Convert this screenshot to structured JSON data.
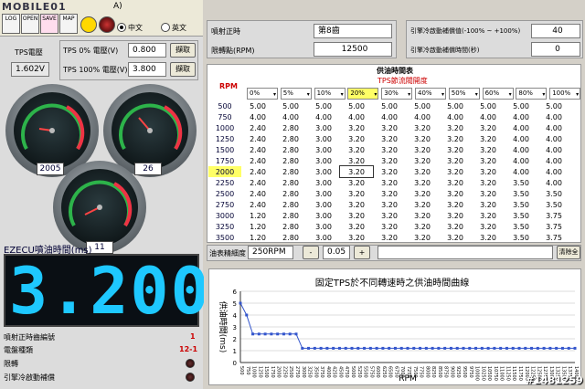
{
  "topbar": {
    "brand": "MOBILE01",
    "title_frag": "A)",
    "icons": [
      "LOG",
      "OPEN",
      "SAVE",
      "MAP"
    ],
    "lang_zh": "中文",
    "lang_en": "英文"
  },
  "tps": {
    "voltage_label": "TPS電壓",
    "voltage_value": "1.602V",
    "tps0_label": "TPS 0% 電壓(V)",
    "tps0_value": "0.800",
    "tps100_label": "TPS 100% 電壓(V)",
    "tps100_value": "3.800",
    "capture_label": "擷取"
  },
  "gauges": {
    "rpm_value": "2005",
    "tps_value": "26",
    "fuel_value": "11"
  },
  "ezecu": {
    "title": "EZECU噴油時間(ms)",
    "digits": "3.200"
  },
  "status": {
    "items": [
      {
        "label": "噴射正時齒編號",
        "value": "1"
      },
      {
        "label": "電盤種類",
        "value": "12-1"
      },
      {
        "label": "限轉",
        "value": ""
      },
      {
        "label": "引擎冷啟動補償",
        "value": ""
      }
    ]
  },
  "right_top": {
    "timing_label": "噴射正時",
    "timing_value": "第8齒",
    "limit_label": "限轉點(RPM)",
    "limit_value": "12500",
    "cold_pct_label": "引擎冷啟動補償值(-100% ~ +100%)",
    "cold_pct_value": "40",
    "cold_time_label": "引擎冷啟動補償時間(秒)",
    "cold_time_value": "0"
  },
  "table": {
    "title": "供油時間表",
    "subtitle": "TPS節流閥開度",
    "rpm_header": "RPM",
    "tps_cols": [
      "0%",
      "5%",
      "10%",
      "20%",
      "30%",
      "40%",
      "50%",
      "60%",
      "80%",
      "100%"
    ],
    "rpm_rows": [
      "500",
      "750",
      "1000",
      "1250",
      "1500",
      "1750",
      "2000",
      "2250",
      "2500",
      "2750",
      "3000",
      "3250",
      "3500"
    ],
    "values": [
      [
        "5.00",
        "5.00",
        "5.00",
        "5.00",
        "5.00",
        "5.00",
        "5.00",
        "5.00",
        "5.00",
        "5.00"
      ],
      [
        "4.00",
        "4.00",
        "4.00",
        "4.00",
        "4.00",
        "4.00",
        "4.00",
        "4.00",
        "4.00",
        "4.00"
      ],
      [
        "2.40",
        "2.80",
        "3.00",
        "3.20",
        "3.20",
        "3.20",
        "3.20",
        "3.20",
        "4.00",
        "4.00"
      ],
      [
        "2.40",
        "2.80",
        "3.00",
        "3.20",
        "3.20",
        "3.20",
        "3.20",
        "3.20",
        "4.00",
        "4.00"
      ],
      [
        "2.40",
        "2.80",
        "3.00",
        "3.20",
        "3.20",
        "3.20",
        "3.20",
        "3.20",
        "4.00",
        "4.00"
      ],
      [
        "2.40",
        "2.80",
        "3.00",
        "3.20",
        "3.20",
        "3.20",
        "3.20",
        "3.20",
        "4.00",
        "4.00"
      ],
      [
        "2.40",
        "2.80",
        "3.00",
        "3.20",
        "3.20",
        "3.20",
        "3.20",
        "3.20",
        "4.00",
        "4.00"
      ],
      [
        "2.40",
        "2.80",
        "3.00",
        "3.20",
        "3.20",
        "3.20",
        "3.20",
        "3.20",
        "3.50",
        "4.00"
      ],
      [
        "2.40",
        "2.80",
        "3.00",
        "3.20",
        "3.20",
        "3.20",
        "3.20",
        "3.20",
        "3.50",
        "3.50"
      ],
      [
        "2.40",
        "2.80",
        "3.00",
        "3.20",
        "3.20",
        "3.20",
        "3.20",
        "3.20",
        "3.50",
        "3.50"
      ],
      [
        "1.20",
        "2.80",
        "3.00",
        "3.20",
        "3.20",
        "3.20",
        "3.20",
        "3.20",
        "3.50",
        "3.75"
      ],
      [
        "1.20",
        "2.80",
        "3.00",
        "3.20",
        "3.20",
        "3.20",
        "3.20",
        "3.20",
        "3.50",
        "3.75"
      ],
      [
        "1.20",
        "2.80",
        "3.00",
        "3.20",
        "3.20",
        "3.20",
        "3.20",
        "3.20",
        "3.50",
        "3.75"
      ]
    ]
  },
  "adjust": {
    "label": "油表精細度",
    "step_value": "250RPM",
    "minus": "-",
    "amount": "0.05",
    "plus": "+",
    "clear_label": "清除全部"
  },
  "chart_data": {
    "type": "line",
    "title": "固定TPS於不同轉速時之供油時間曲線",
    "xlabel": "RPM",
    "ylabel": "供油時間(ms)",
    "ylim": [
      0,
      6
    ],
    "yticks": [
      0,
      1,
      2,
      3,
      4,
      5,
      6
    ],
    "x": [
      "500",
      "750",
      "1000",
      "1250",
      "1500",
      "1750",
      "2000",
      "2250",
      "2500",
      "2750",
      "3000",
      "3250",
      "3500",
      "3750",
      "4000",
      "4250",
      "4500",
      "4750",
      "5000",
      "5250",
      "5500",
      "5750",
      "6000",
      "6250",
      "6500",
      "6750",
      "7000",
      "7250",
      "7500",
      "7750",
      "8000",
      "8250",
      "8500",
      "8750",
      "9000",
      "9250",
      "9500",
      "9750",
      "10000",
      "10250",
      "10500",
      "10750",
      "11000",
      "11250",
      "11500",
      "11750",
      "12000",
      "12250",
      "12500",
      "12750",
      "13000",
      "13250",
      "13500",
      "13750",
      "14000"
    ],
    "series": [
      {
        "values": [
          5,
          4,
          2.4,
          2.4,
          2.4,
          2.4,
          2.4,
          2.4,
          2.4,
          2.4,
          1.2,
          1.2,
          1.2,
          1.2,
          1.2,
          1.2,
          1.2,
          1.2,
          1.2,
          1.2,
          1.2,
          1.2,
          1.2,
          1.2,
          1.2,
          1.2,
          1.2,
          1.2,
          1.2,
          1.2,
          1.2,
          1.2,
          1.2,
          1.2,
          1.2,
          1.2,
          1.2,
          1.2,
          1.2,
          1.2,
          1.2,
          1.2,
          1.2,
          1.2,
          1.2,
          1.2,
          1.2,
          1.2,
          1.2,
          1.2,
          1.2,
          1.2,
          1.2,
          1.2,
          1.2
        ]
      }
    ]
  },
  "watermark": "#1481259"
}
